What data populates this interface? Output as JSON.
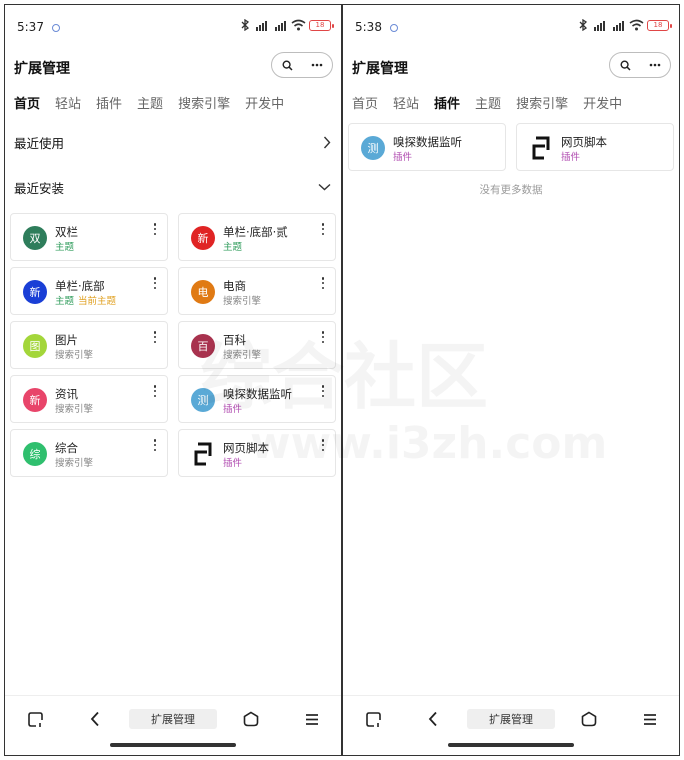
{
  "screens": [
    {
      "status": {
        "time": "5:37",
        "battery": "18"
      },
      "app_title": "扩展管理",
      "tabs": [
        {
          "label": "首页",
          "active": true
        },
        {
          "label": "轻站",
          "active": false
        },
        {
          "label": "插件",
          "active": false
        },
        {
          "label": "主题",
          "active": false
        },
        {
          "label": "搜索引擎",
          "active": false
        },
        {
          "label": "开发中",
          "active": false
        }
      ],
      "sections": {
        "recent_used": "最近使用",
        "recent_installed": "最近安装"
      },
      "cards": [
        {
          "icon_text": "双",
          "icon_color": "#2e7d5b",
          "name": "双栏",
          "type": "主题",
          "type_color": "#2e9b5a",
          "status": ""
        },
        {
          "icon_text": "新",
          "icon_color": "#e02424",
          "name": "单栏·底部·贰",
          "type": "主题",
          "type_color": "#2e9b5a",
          "status": ""
        },
        {
          "icon_text": "新",
          "icon_color": "#1a3fd6",
          "name": "单栏·底部",
          "type": "主题",
          "type_color": "#2e9b5a",
          "status": "当前主题",
          "status_color": "#e0a020"
        },
        {
          "icon_text": "电",
          "icon_color": "#e07a14",
          "name": "电商",
          "type": "搜索引擎",
          "type_color": "#888888",
          "status": ""
        },
        {
          "icon_text": "图",
          "icon_color": "#a3d63a",
          "name": "图片",
          "type": "搜索引擎",
          "type_color": "#888888",
          "status": ""
        },
        {
          "icon_text": "百",
          "icon_color": "#a8324e",
          "name": "百科",
          "type": "搜索引擎",
          "type_color": "#888888",
          "status": ""
        },
        {
          "icon_text": "新",
          "icon_color": "#e8456a",
          "name": "资讯",
          "type": "搜索引擎",
          "type_color": "#888888",
          "status": ""
        },
        {
          "icon_text": "测",
          "icon_color": "#5aa9d6",
          "name": "嗅探数据监听",
          "type": "插件",
          "type_color": "#b04bb0",
          "status": ""
        },
        {
          "icon_text": "综",
          "icon_color": "#2fbf6e",
          "name": "综合",
          "type": "搜索引擎",
          "type_color": "#888888",
          "status": ""
        },
        {
          "icon_text": "",
          "icon_color": "#111111",
          "name": "网页脚本",
          "type": "插件",
          "type_color": "#b04bb0",
          "status": ""
        }
      ],
      "nav_label": "扩展管理"
    },
    {
      "status": {
        "time": "5:38",
        "battery": "18"
      },
      "app_title": "扩展管理",
      "tabs": [
        {
          "label": "首页",
          "active": false
        },
        {
          "label": "轻站",
          "active": false
        },
        {
          "label": "插件",
          "active": true
        },
        {
          "label": "主题",
          "active": false
        },
        {
          "label": "搜索引擎",
          "active": false
        },
        {
          "label": "开发中",
          "active": false
        }
      ],
      "cards": [
        {
          "icon_text": "测",
          "icon_color": "#5aa9d6",
          "name": "嗅探数据监听",
          "type": "插件",
          "type_color": "#b04bb0"
        },
        {
          "icon_text": "",
          "icon_color": "#111111",
          "name": "网页脚本",
          "type": "插件",
          "type_color": "#b04bb0"
        }
      ],
      "empty_text": "没有更多数据",
      "nav_label": "扩展管理"
    }
  ],
  "watermark": {
    "line1": "综合社区",
    "line2": "www.i3zh.com"
  },
  "icons": {
    "search": "search-icon",
    "more": "more-icon",
    "chevron_right": "chevron-right-icon",
    "chevron_down": "chevron-down-icon",
    "card_menu": "vertical-dots-icon",
    "nav": [
      "recent-apps-icon",
      "back-icon",
      "home-icon",
      "menu-icon"
    ]
  }
}
